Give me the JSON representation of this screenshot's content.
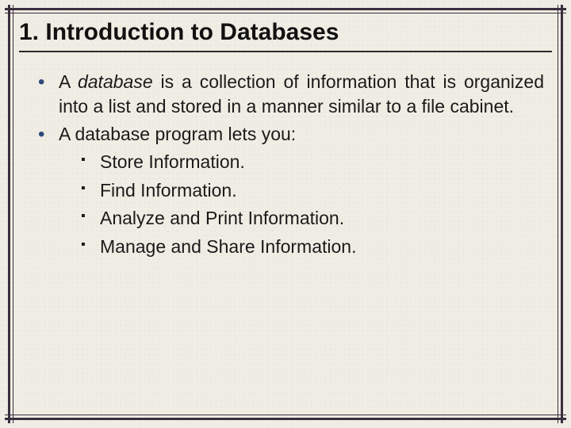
{
  "title": "1. Introduction to Databases",
  "bullets": [
    {
      "pre": "A ",
      "em": "database",
      "post": " is a collection of information that is organized into a list and stored in a manner similar to a file cabinet."
    },
    {
      "text": "A database program lets you:",
      "sub": [
        "Store Information.",
        "Find Information.",
        "Analyze and Print Information.",
        "Manage and Share Information."
      ]
    }
  ]
}
